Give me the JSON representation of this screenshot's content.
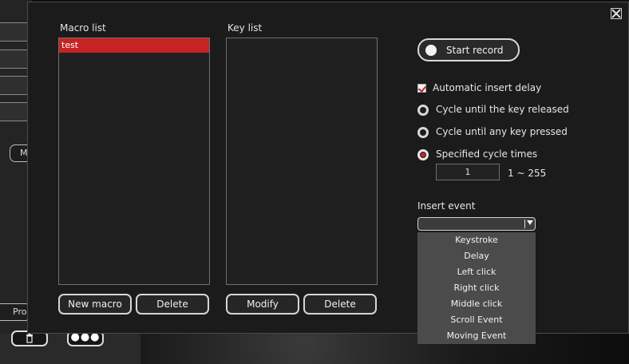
{
  "background_app": {
    "m_button_label": "M",
    "pro_button_label": "Pro",
    "trash_icon": "trash-icon",
    "more_label": "●●●"
  },
  "dialog": {
    "close_icon": "close-icon",
    "macro_list": {
      "label": "Macro list",
      "items": [
        "test"
      ],
      "selected_index": 0
    },
    "key_list": {
      "label": "Key list",
      "items": []
    },
    "buttons": {
      "new_macro": "New macro",
      "delete_macro": "Delete",
      "modify": "Modify",
      "delete_key": "Delete"
    },
    "start_record": "Start record",
    "options": {
      "automatic_insert_delay": "Automatic insert delay",
      "cycle_until_released": "Cycle until the key released",
      "cycle_until_any_key": "Cycle until any key pressed",
      "specified_cycle_times": "Specified cycle times",
      "automatic_insert_delay_checked": true,
      "selected_cycle_mode": "Specified cycle times"
    },
    "cycle_times_value": "1",
    "cycle_range": "1 ~ 255",
    "insert_event": {
      "label": "Insert event",
      "value": "",
      "options": [
        "Keystroke",
        "Delay",
        "Left click",
        "Right click",
        "Middle click",
        "Scroll Event",
        "Moving Event"
      ]
    }
  },
  "colors": {
    "accent": "#c62323",
    "dialog_bg": "#1b1b1b",
    "dropdown_bg": "#4b4b4b"
  }
}
